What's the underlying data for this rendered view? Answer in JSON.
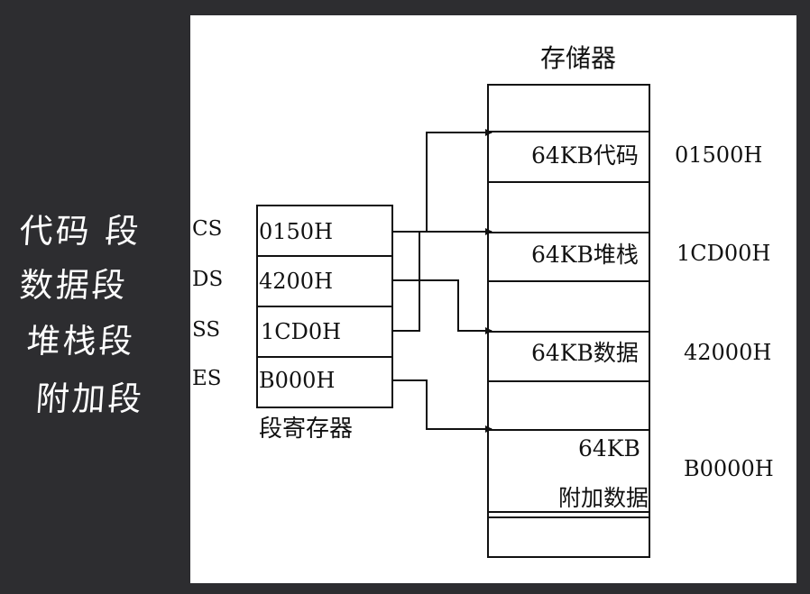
{
  "handwritten_labels": [
    "代码 段",
    "数据段",
    "堆栈段",
    "附加段"
  ],
  "segment_registers": {
    "caption": "段寄存器",
    "registers": [
      {
        "name": "CS",
        "value": "0150H"
      },
      {
        "name": "DS",
        "value": "4200H"
      },
      {
        "name": "SS",
        "value": "1CD0H"
      },
      {
        "name": "ES",
        "value": "B000H"
      }
    ]
  },
  "memory": {
    "title": "存储器",
    "segments": [
      {
        "label": "64KB代码",
        "address": "01500H"
      },
      {
        "label": "64KB堆栈",
        "address": "1CD00H"
      },
      {
        "label": "64KB数据",
        "address": "42000H"
      },
      {
        "label_line1": "64KB",
        "label_line2": "附加数据",
        "address": "B0000H"
      }
    ]
  }
}
